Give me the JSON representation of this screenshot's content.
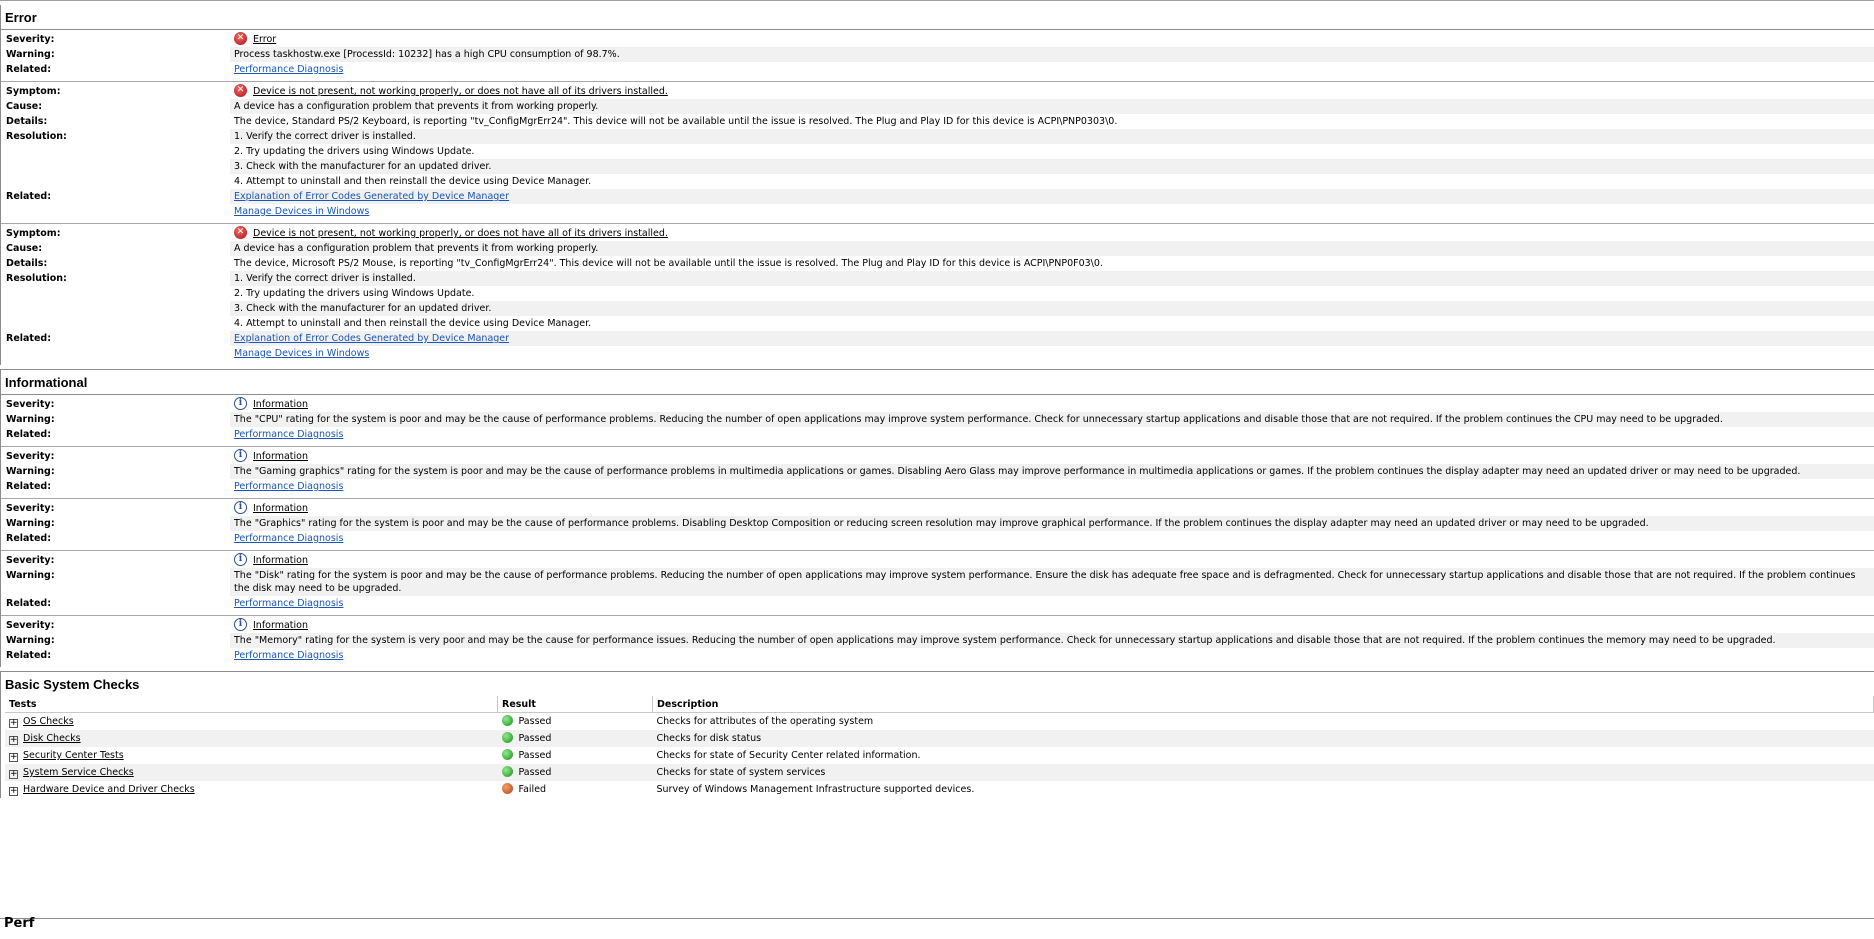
{
  "error_section": {
    "title": "Error",
    "blocks": [
      {
        "rows": [
          {
            "label": "Severity:",
            "value": "Error",
            "icon": "error-icon"
          },
          {
            "label": "Warning:",
            "value": "Process taskhostw.exe [ProcessId: 10232] has a high CPU consumption of 98.7%."
          },
          {
            "label": "Related:",
            "value": "Performance Diagnosis"
          }
        ]
      },
      {
        "rows": [
          {
            "label": "Symptom:",
            "value": "Device is not present, not working properly, or does not have all of its drivers installed.",
            "icon": "error-icon"
          },
          {
            "label": "Cause:",
            "value": "A device has a configuration problem that prevents it from working properly."
          },
          {
            "label": "Details:",
            "value": "The device, Standard PS/2 Keyboard, is reporting \"tv_ConfigMgrErr24\". This device will not be available until the issue is resolved. The Plug and Play ID for this device is ACPI\\PNP0303\\0."
          },
          {
            "label": "Resolution:",
            "value": "1. Verify the correct driver is installed."
          },
          {
            "label": "",
            "value": "2. Try updating the drivers using Windows Update."
          },
          {
            "label": "",
            "value": "3. Check with the manufacturer for an updated driver."
          },
          {
            "label": "",
            "value": "4. Attempt to uninstall and then reinstall the device using Device Manager."
          },
          {
            "label": "Related:",
            "value": "Explanation of Error Codes Generated by Device Manager"
          },
          {
            "label": "",
            "value": "Manage Devices in Windows"
          }
        ]
      },
      {
        "rows": [
          {
            "label": "Symptom:",
            "value": "Device is not present, not working properly, or does not have all of its drivers installed.",
            "icon": "error-icon"
          },
          {
            "label": "Cause:",
            "value": "A device has a configuration problem that prevents it from working properly."
          },
          {
            "label": "Details:",
            "value": "The device, Microsoft PS/2 Mouse, is reporting \"tv_ConfigMgrErr24\". This device will not be available until the issue is resolved. The Plug and Play ID for this device is ACPI\\PNP0F03\\0."
          },
          {
            "label": "Resolution:",
            "value": "1. Verify the correct driver is installed."
          },
          {
            "label": "",
            "value": "2. Try updating the drivers using Windows Update."
          },
          {
            "label": "",
            "value": "3. Check with the manufacturer for an updated driver."
          },
          {
            "label": "",
            "value": "4. Attempt to uninstall and then reinstall the device using Device Manager."
          },
          {
            "label": "Related:",
            "value": "Explanation of Error Codes Generated by Device Manager"
          },
          {
            "label": "",
            "value": "Manage Devices in Windows"
          }
        ]
      }
    ]
  },
  "info_section": {
    "title": "Informational",
    "blocks": [
      {
        "severity": "Information",
        "warning": "The \"CPU\" rating for the system is poor and may be the cause of performance problems. Reducing the number of open applications may improve system performance. Check for unnecessary startup applications and disable those that are not required. If the problem continues the CPU may need to be upgraded.",
        "related": "Performance Diagnosis"
      },
      {
        "severity": "Information",
        "warning": "The \"Gaming graphics\" rating for the system is poor and may be the cause of performance problems in multimedia applications or games. Disabling Aero Glass may improve performance in multimedia applications or games. If the problem continues the display adapter may need an updated driver or may need to be upgraded.",
        "related": "Performance Diagnosis"
      },
      {
        "severity": "Information",
        "warning": "The \"Graphics\" rating for the system is poor and may be the cause of performance problems. Disabling Desktop Composition or reducing screen resolution may improve graphical performance. If the problem continues the display adapter may need an updated driver or may need to be upgraded.",
        "related": "Performance Diagnosis"
      },
      {
        "severity": "Information",
        "warning": "The \"Disk\" rating for the system is poor and may be the cause of performance problems. Reducing the number of open applications may improve system performance. Ensure the disk has adequate free space and is defragmented. Check for unnecessary startup applications and disable those that are not required. If the problem continues the disk may need to be upgraded.",
        "related": "Performance Diagnosis",
        "wrap": true
      },
      {
        "severity": "Information",
        "warning": "The \"Memory\" rating for the system is very poor and may be the cause for performance issues. Reducing the number of open applications may improve system performance. Check for unnecessary startup applications and disable those that are not required. If the problem continues the memory may need to be upgraded.",
        "related": "Performance Diagnosis"
      }
    ],
    "labels": {
      "severity": "Severity:",
      "warning": "Warning:",
      "related": "Related:"
    }
  },
  "basic_checks": {
    "title": "Basic System Checks",
    "columns": [
      "Tests",
      "Result",
      "Description"
    ],
    "rows": [
      {
        "test": "OS Checks",
        "result": "Passed",
        "status": "ok",
        "description": "Checks for attributes of the operating system"
      },
      {
        "test": "Disk Checks",
        "result": "Passed",
        "status": "ok",
        "description": "Checks for disk status"
      },
      {
        "test": "Security Center Tests",
        "result": "Passed",
        "status": "ok",
        "description": "Checks for state of Security Center related information."
      },
      {
        "test": "System Service Checks",
        "result": "Passed",
        "status": "ok",
        "description": "Checks for state of system services"
      },
      {
        "test": "Hardware Device and Driver Checks",
        "result": "Failed",
        "status": "fail",
        "description": "Survey of Windows Management Infrastructure supported devices."
      }
    ],
    "expand_glyph": "+"
  },
  "next_section": {
    "title": "Perf"
  },
  "colors": {
    "link": "#1a55b8",
    "passed": "#1c8f1c",
    "failed": "#b5420e",
    "error_icon": "#b01010",
    "info_icon": "#2c4d9a"
  }
}
